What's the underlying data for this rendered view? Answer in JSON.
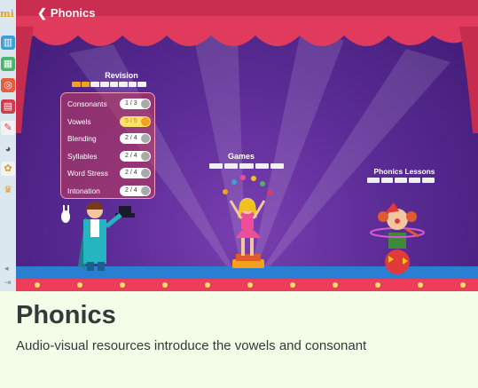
{
  "header": {
    "back_label": "Phonics"
  },
  "sidebar": {
    "logo_text": "mi",
    "collapse_glyph": "◂",
    "exit_glyph": "⇥"
  },
  "revision": {
    "title": "Revision",
    "progress": {
      "filled": 2,
      "total": 8
    },
    "items": [
      {
        "label": "Consonants",
        "score": "1 / 3"
      },
      {
        "label": "Vowels",
        "score": "5 / 5",
        "highlight": true
      },
      {
        "label": "Blending",
        "score": "2 / 4"
      },
      {
        "label": "Syllables",
        "score": "2 / 4"
      },
      {
        "label": "Word Stress",
        "score": "2 / 4"
      },
      {
        "label": "Intonation",
        "score": "2 / 4"
      }
    ]
  },
  "games": {
    "title": "Games",
    "segments": 5
  },
  "lessons": {
    "title": "Phonics Lessons",
    "segments": 5
  },
  "footer": {
    "title": "Phonics",
    "description": "Audio-visual resources introduce the vowels and consonant"
  },
  "colors": {
    "accent": "#f4a11d",
    "curtain": "#e03a5c",
    "stage": "#5a2b95"
  }
}
